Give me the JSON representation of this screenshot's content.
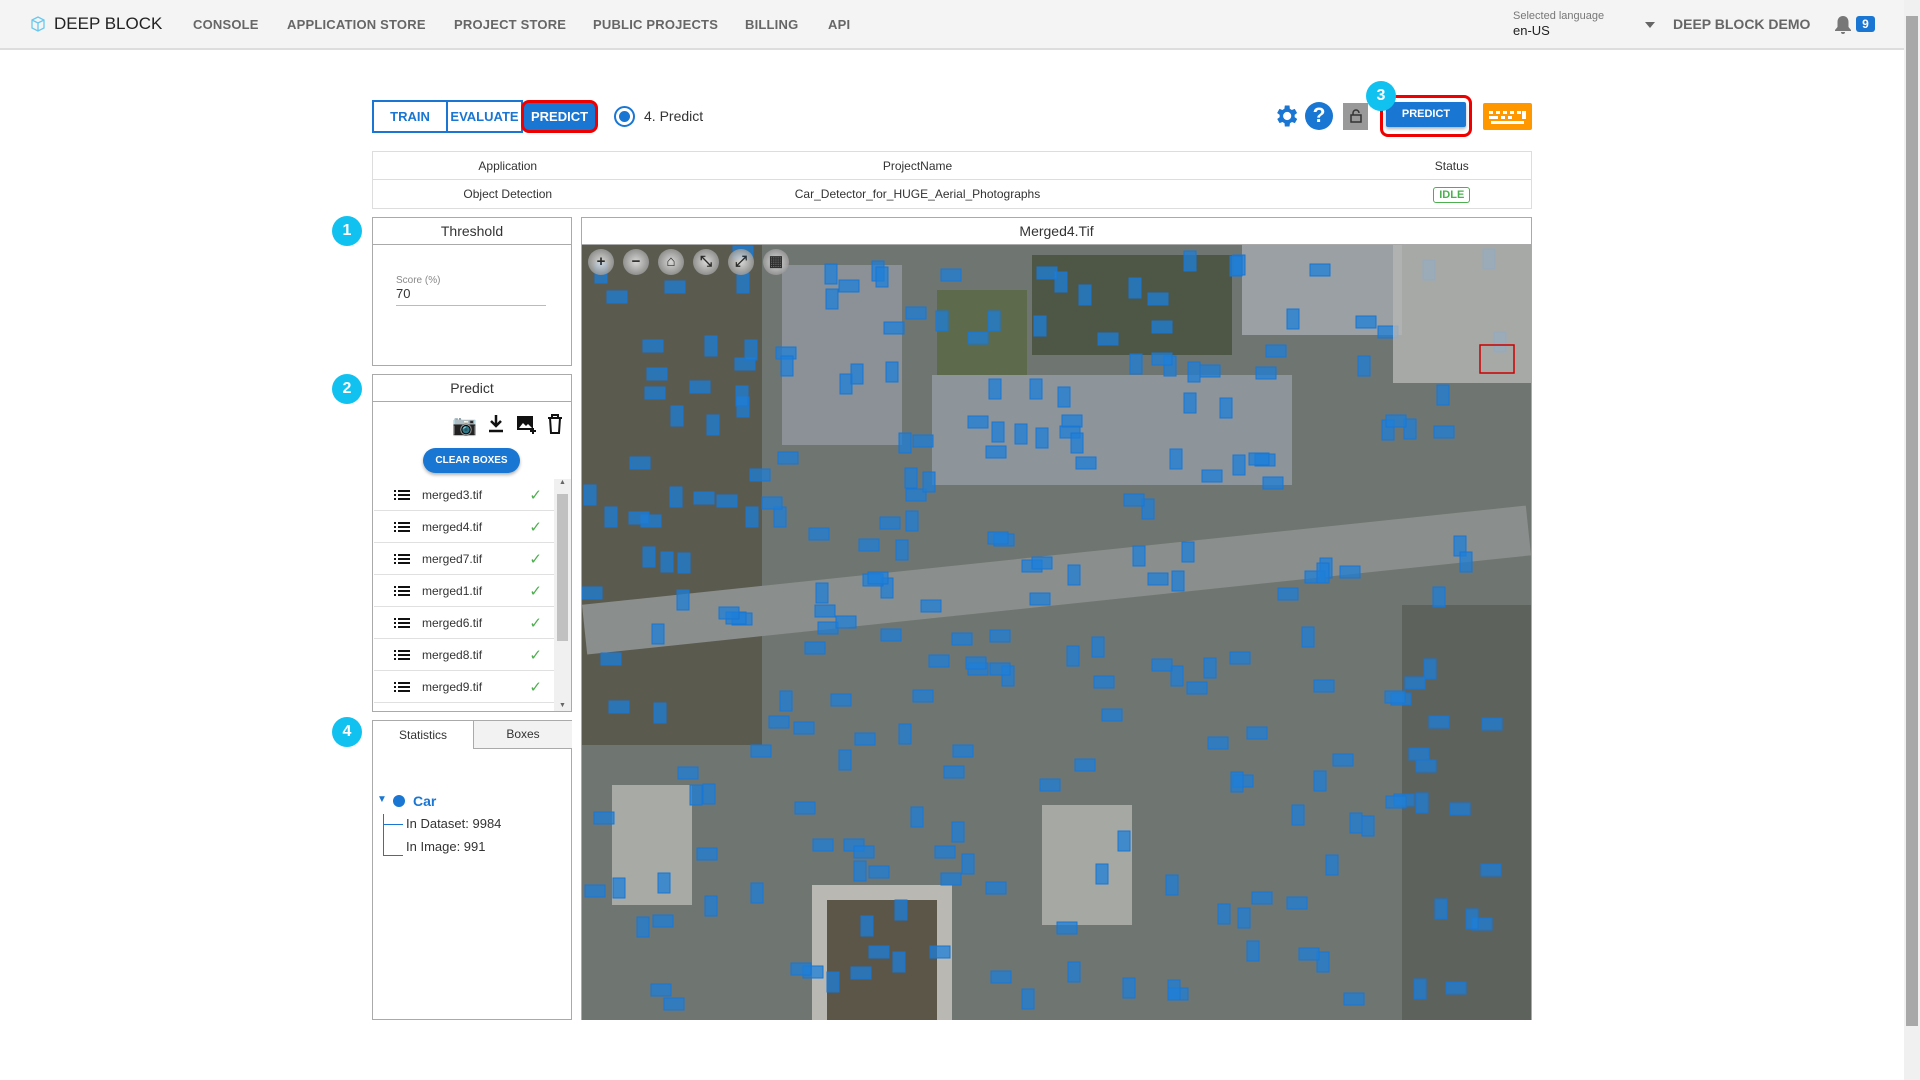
{
  "header": {
    "logo": "DEEP BLOCK",
    "nav": [
      "CONSOLE",
      "APPLICATION STORE",
      "PROJECT STORE",
      "PUBLIC PROJECTS",
      "BILLING",
      "API"
    ],
    "language_label": "Selected language",
    "language_value": "en-US",
    "user": "DEEP BLOCK DEMO",
    "notifications": "9"
  },
  "toolbar": {
    "tabs": [
      "TRAIN",
      "EVALUATE",
      "PREDICT"
    ],
    "active_tab": "PREDICT",
    "step_label": "4. Predict",
    "predict_button": "PREDICT",
    "step3": "3"
  },
  "project_table": {
    "headers": [
      "Application",
      "ProjectName",
      "Status"
    ],
    "row": [
      "Object Detection",
      "Car_Detector_for_HUGE_Aerial_Photographs",
      "IDLE"
    ]
  },
  "threshold": {
    "step": "1",
    "title": "Threshold",
    "score_label": "Score (%)",
    "score_value": "70"
  },
  "predict": {
    "step": "2",
    "title": "Predict",
    "clear_button": "CLEAR BOXES",
    "files": [
      "merged3.tif",
      "merged4.tif",
      "merged7.tif",
      "merged1.tif",
      "merged6.tif",
      "merged8.tif",
      "merged9.tif"
    ]
  },
  "stats": {
    "step": "4",
    "tabs": [
      "Statistics",
      "Boxes"
    ],
    "class_name": "Car",
    "in_dataset": "In Dataset: 9984",
    "in_image": "In Image: 991"
  },
  "viewer": {
    "title": "Merged4.Tif"
  },
  "colors": {
    "accent": "#1976d2",
    "step": "#11c2f0",
    "highlight": "#e00000",
    "idle": "#4caf50",
    "keyboard": "#ff9800"
  }
}
